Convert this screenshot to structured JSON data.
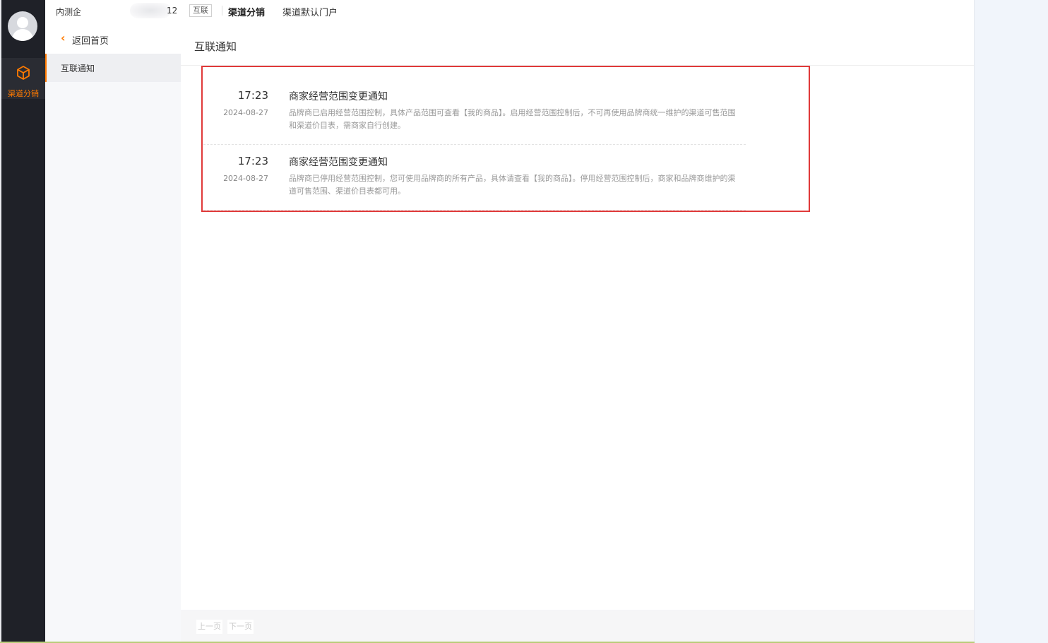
{
  "rail": {
    "nav_label": "渠道分销",
    "accent": "#ff7a00"
  },
  "topbar": {
    "company_prefix": "内测企",
    "company_suffix": "12",
    "tag": "互联",
    "nav_active": "渠道分销",
    "nav_link": "渠道默认门户"
  },
  "subnav": {
    "back_label": "返回首页",
    "item_label": "互联通知"
  },
  "main": {
    "title": "互联通知",
    "notices": [
      {
        "time": "17:23",
        "date": "2024-08-27",
        "title": "商家经营范围变更通知",
        "desc": "品牌商已启用经营范围控制，具体产品范围可查看【我的商品】。启用经营范围控制后，不可再使用品牌商统一维护的渠道可售范围和渠道价目表，需商家自行创建。"
      },
      {
        "time": "17:23",
        "date": "2024-08-27",
        "title": "商家经营范围变更通知",
        "desc": "品牌商已停用经营范围控制，您可使用品牌商的所有产品，具体请查看【我的商品】。停用经营范围控制后，商家和品牌商维护的渠道可售范围、渠道价目表都可用。"
      }
    ],
    "pager": {
      "prev": "上一页",
      "next": "下一页"
    }
  },
  "colors": {
    "highlight_border": "#e03a3a",
    "rail_bg": "#1f2128",
    "right_pane_bg": "#f1f5fb"
  }
}
